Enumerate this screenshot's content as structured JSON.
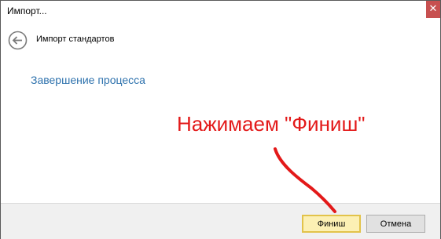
{
  "window": {
    "title": "Импорт...",
    "close_glyph": "✕"
  },
  "header": {
    "title": "Импорт стандартов",
    "back_icon": "back-arrow-circle-icon"
  },
  "main": {
    "step_title": "Завершение процесса"
  },
  "annotation": {
    "text": "Нажимаем \"Финиш\"",
    "color": "#e31919"
  },
  "footer": {
    "finish_label": "Финиш",
    "cancel_label": "Отмена"
  },
  "colors": {
    "step_title": "#2e72ad",
    "finish_bg": "#fcf0b4",
    "close_bg": "#c75050"
  }
}
